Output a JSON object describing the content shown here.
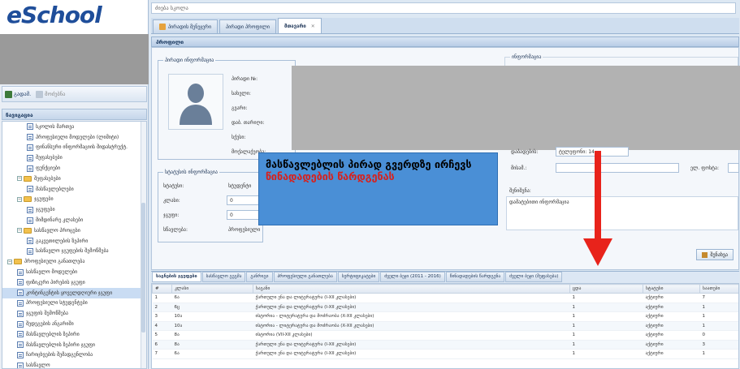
{
  "app": {
    "logo": "eSchool"
  },
  "sidebar": {
    "toolbar": {
      "btn1": "გადამ.",
      "btn2": "მოძებნა"
    },
    "header": "ნავიგაცია",
    "tree": [
      {
        "label": "სკოლის მართვა",
        "type": "doc",
        "indent": 2
      },
      {
        "label": "პროფესიული მოდულები (ლიმიტი)",
        "type": "doc",
        "indent": 2
      },
      {
        "label": "ფინანსური ინფორმაციის შიდასტრუქტ.",
        "type": "doc",
        "indent": 2
      },
      {
        "label": "შეფასებები",
        "type": "doc",
        "indent": 2
      },
      {
        "label": "ფუნქციები",
        "type": "doc",
        "indent": 2
      },
      {
        "label": "შეფასებები",
        "type": "folder",
        "indent": 1
      },
      {
        "label": "მასწავლებლები",
        "type": "doc",
        "indent": 2
      },
      {
        "label": "ჯგუფები",
        "type": "folder",
        "indent": 1
      },
      {
        "label": "ჯგუფები",
        "type": "doc",
        "indent": 2
      },
      {
        "label": "მიმდინარე კლასები",
        "type": "doc",
        "indent": 2
      },
      {
        "label": "სასწავლო პროცესი",
        "type": "folder",
        "indent": 1
      },
      {
        "label": "გაკვეთილების ზეპირი",
        "type": "doc",
        "indent": 2
      },
      {
        "label": "სასწავლო ჯგუფების შემოწმება",
        "type": "doc",
        "indent": 2
      },
      {
        "label": "პროფესიული განათლება",
        "type": "folder",
        "indent": 0
      },
      {
        "label": "სასწავლო მოდულები",
        "type": "doc",
        "indent": 1
      },
      {
        "label": "ფიზიკური პირების ჯგუფი",
        "type": "doc",
        "indent": 1
      },
      {
        "label": "კონტინგენტის ყოველდღიური ჯგუფი",
        "type": "doc",
        "indent": 1,
        "selected": true
      },
      {
        "label": "პროფესიული სტუდენტები",
        "type": "doc",
        "indent": 1
      },
      {
        "label": "ჯგუფის შემოწმება",
        "type": "doc",
        "indent": 1
      },
      {
        "label": "შედეგების ანგარიში",
        "type": "doc",
        "indent": 1
      },
      {
        "label": "მასწავლებლის ზეპირი",
        "type": "doc",
        "indent": 1
      },
      {
        "label": "მასწავლებლის ზეპირი ჯგუფი",
        "type": "doc",
        "indent": 1
      },
      {
        "label": "ჩარიცხვების შემადგენლობა",
        "type": "doc",
        "indent": 1
      },
      {
        "label": "სასწავლო",
        "type": "doc",
        "indent": 1
      }
    ]
  },
  "main": {
    "search_placeholder": "ძიება სკოლა",
    "tabs": [
      {
        "label": "პირადის მენეჯერი",
        "active": false
      },
      {
        "label": "პირადი პროფილი",
        "active": false
      },
      {
        "label": "მთავარი",
        "active": true
      }
    ],
    "panel_title": "პროფილი",
    "personal": {
      "legend": "პირადი ინფორმაცია",
      "fields": [
        "პირადი №:",
        "სახელი:",
        "გვარი:",
        "დაბ. თარიღი:",
        "სქესი:",
        "მოქალაქეობა:"
      ]
    },
    "right_group_legend": "ინფორმაცია",
    "right_fields": {
      "label1": "დაბადების:",
      "value1": "ტელეფონი: 14",
      "label2": "მისამ.:",
      "label3": "ელ. ფოსტა:"
    },
    "status": {
      "legend": "სტატუსის ინფორმაცია",
      "rows": [
        {
          "label": "სტატუსი:",
          "value": "სტუდენტი"
        },
        {
          "label": "კლასი:",
          "value": "0"
        },
        {
          "label": "ჯგუფი:",
          "value": "0"
        },
        {
          "label": "სწავლება:",
          "value": "პროფესიული"
        }
      ]
    },
    "notes": {
      "label": "შენიშვნა:",
      "value": "დამატებითი ინფორმაცია"
    },
    "right_button": "შენახვა",
    "callout": {
      "line1": "მასწავლებლის პირად გვერდზე ირჩევს",
      "line2": "წინადადების წარდგენას"
    },
    "bottom_tabs": [
      {
        "label": "საგნების ჯგუფები",
        "active": true
      },
      {
        "label": "სასწავლო გეგმა",
        "active": false
      },
      {
        "label": "განრიგი",
        "active": false
      },
      {
        "label": "პროფესიული განათლება",
        "active": false
      },
      {
        "label": "სერტიფიკატები",
        "active": false
      },
      {
        "label": "ძველი ბეჯი (2011 - 2016)",
        "active": false
      },
      {
        "label": "წინადადების წარდგენა",
        "active": false
      },
      {
        "label": "ძველი ბეჯი (შეფასება)",
        "active": false
      }
    ],
    "grid": {
      "columns": [
        "#",
        "კლასი",
        "საგანი",
        "ცდა",
        "სტატუსი",
        "საათები"
      ],
      "rows": [
        [
          "1",
          "6ა",
          "ქართული ენა და ლიტერატურა (I-XII კლასები)",
          "1",
          "აქტიური",
          "7"
        ],
        [
          "2",
          "6ც",
          "ქართული ენა და ლიტერატურა (I-XII კლასები)",
          "1",
          "აქტიური",
          "1"
        ],
        [
          "3",
          "10ა",
          "ისტორია - ლიტერატურა და მოძრაობა (X-XII კლასები)",
          "1",
          "აქტიური",
          "1"
        ],
        [
          "4",
          "10ა",
          "ისტორია - ლიტერატურა და მოძრაობა (X-XII კლასები)",
          "1",
          "აქტიური",
          "1"
        ],
        [
          "5",
          "8ა",
          "ისტორია (VII-XII კლასები)",
          "1",
          "აქტიური",
          "0"
        ],
        [
          "6",
          "8ა",
          "ქართული ენა და ლიტერატურა (I-XII კლასები)",
          "1",
          "აქტიური",
          "3"
        ],
        [
          "7",
          "6ა",
          "ქართული ენა და ლიტერატურა (I-XII კლასები)",
          "1",
          "აქტიური",
          "1"
        ]
      ]
    }
  },
  "colors": {
    "brand": "#1f4e9a",
    "callout_bg": "#4a8fd6",
    "callout_accent": "#d8201b",
    "arrow": "#e8231b"
  }
}
